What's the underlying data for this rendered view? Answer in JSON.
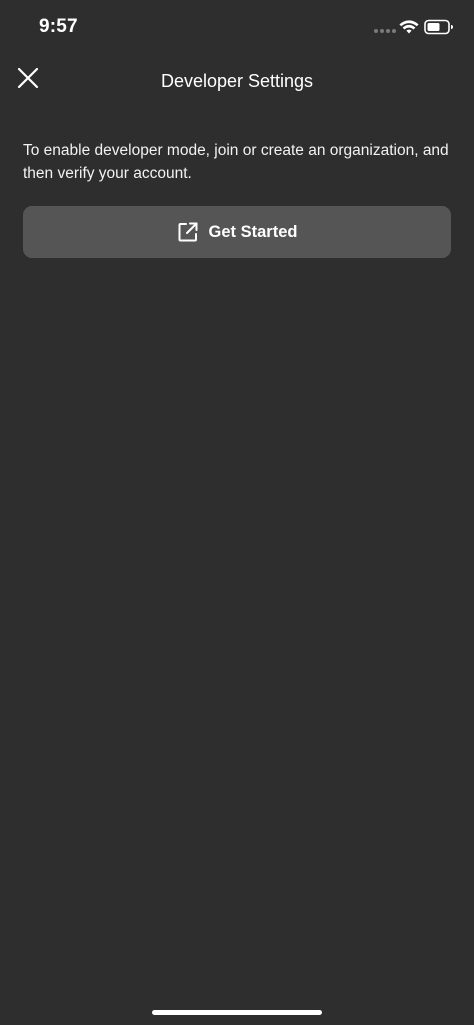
{
  "status_bar": {
    "time": "9:57",
    "icons": [
      "signal-dots-icon",
      "wifi-icon",
      "battery-icon"
    ]
  },
  "nav": {
    "title": "Developer Settings",
    "close_icon": "close-icon"
  },
  "content": {
    "description": "To enable developer mode, join or create an organization, and then verify your account.",
    "get_started": {
      "label": "Get Started",
      "icon": "external-link-icon"
    }
  },
  "colors": {
    "background": "#2e2e2e",
    "button_background": "#555555",
    "text": "#ffffff"
  }
}
